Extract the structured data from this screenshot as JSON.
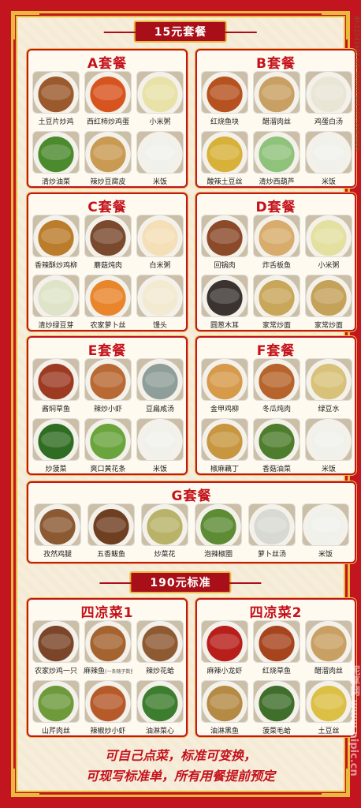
{
  "banners": {
    "set15": "15元套餐",
    "set190": "190元标准"
  },
  "sets": [
    {
      "title": "A套餐",
      "dishes": [
        {
          "name": "土豆片炒鸡",
          "color": "#9a5a2c"
        },
        {
          "name": "西红柿炒鸡蛋",
          "color": "#d8541f"
        },
        {
          "name": "小米粥",
          "color": "#e8e2a8"
        },
        {
          "name": "清炒油菜",
          "color": "#4c8a2e"
        },
        {
          "name": "辣炒豆腐皮",
          "color": "#c99a52"
        },
        {
          "name": "米饭",
          "color": "#f1f1ec"
        }
      ]
    },
    {
      "title": "B套餐",
      "dishes": [
        {
          "name": "红烧鱼块",
          "color": "#b6521f"
        },
        {
          "name": "醋溜肉丝",
          "color": "#c9a063"
        },
        {
          "name": "鸡蛋白汤",
          "color": "#e9e6d6"
        },
        {
          "name": "酸辣土豆丝",
          "color": "#d8b13a"
        },
        {
          "name": "清炒西葫芦",
          "color": "#8fc27a"
        },
        {
          "name": "米饭",
          "color": "#f1f1ec"
        }
      ]
    },
    {
      "title": "C套餐",
      "dishes": [
        {
          "name": "香辣酥炒鸡柳",
          "color": "#bb7c2b"
        },
        {
          "name": "蘑菇炖肉",
          "color": "#7a4a2f"
        },
        {
          "name": "白米粥",
          "color": "#f4dfb6"
        },
        {
          "name": "清炒绿豆芽",
          "color": "#dfe4c8"
        },
        {
          "name": "农家萝卜丝",
          "color": "#e9852a"
        },
        {
          "name": "馒头",
          "color": "#f3ead2"
        }
      ]
    },
    {
      "title": "D套餐",
      "dishes": [
        {
          "name": "回锅肉",
          "color": "#8b4a2a"
        },
        {
          "name": "炸舌板鱼",
          "color": "#d8ac6c"
        },
        {
          "name": "小米粥",
          "color": "#e3e0a0"
        },
        {
          "name": "圆葱木耳",
          "color": "#3a3330"
        },
        {
          "name": "家常炒面",
          "color": "#c9a75a"
        },
        {
          "name": "家常炒面",
          "color": "#c4a25a"
        }
      ]
    },
    {
      "title": "E套餐",
      "dishes": [
        {
          "name": "酱焖草鱼",
          "color": "#9c3a22"
        },
        {
          "name": "辣炒小虾",
          "color": "#b96a34"
        },
        {
          "name": "豆扁咸汤",
          "color": "#8f9e98"
        },
        {
          "name": "炒菠菜",
          "color": "#2f6d22"
        },
        {
          "name": "爽口黄花条",
          "color": "#6aa43c"
        },
        {
          "name": "米饭",
          "color": "#f1f1ec"
        }
      ]
    },
    {
      "title": "F套餐",
      "dishes": [
        {
          "name": "金甲鸡柳",
          "color": "#d69a4a"
        },
        {
          "name": "冬瓜炖肉",
          "color": "#b6642b"
        },
        {
          "name": "绿豆水",
          "color": "#d8c27a"
        },
        {
          "name": "椒麻藕丁",
          "color": "#c7963f"
        },
        {
          "name": "香菇油菜",
          "color": "#4d7d2d"
        },
        {
          "name": "米饭",
          "color": "#f1f1ec"
        }
      ]
    }
  ],
  "setG": {
    "title": "G套餐",
    "dishes": [
      {
        "name": "孜然鸡腿",
        "color": "#8c5a32"
      },
      {
        "name": "五香鲅鱼",
        "color": "#6f3f22"
      },
      {
        "name": "炒菜花",
        "color": "#b9b36a"
      },
      {
        "name": "泡辣椒圈",
        "color": "#5d8c35"
      },
      {
        "name": "萝卜丝汤",
        "color": "#d9d9d3"
      },
      {
        "name": "米饭",
        "color": "#f1f1ec"
      }
    ]
  },
  "cold_sets": [
    {
      "title": "四凉菜1",
      "dishes": [
        {
          "name": "农家炒鸡一只",
          "color": "#7a4528",
          "sub": ""
        },
        {
          "name": "麻辣鱼",
          "color": "#a4632f",
          "sub": "(一条随子数量)"
        },
        {
          "name": "辣炒花蛤",
          "color": "#8d5a32",
          "sub": ""
        },
        {
          "name": "山芹肉丝",
          "color": "#6e9a3c",
          "sub": ""
        },
        {
          "name": "辣椒炒小虾",
          "color": "#b65a2a",
          "sub": ""
        },
        {
          "name": "油淋菜心",
          "color": "#3d7d2e",
          "sub": ""
        }
      ]
    },
    {
      "title": "四凉菜2",
      "dishes": [
        {
          "name": "麻辣小龙虾",
          "color": "#b81f1a",
          "sub": ""
        },
        {
          "name": "红烧草鱼",
          "color": "#a6441e",
          "sub": ""
        },
        {
          "name": "醋溜肉丝",
          "color": "#c9a063",
          "sub": ""
        },
        {
          "name": "油淋黑鱼",
          "color": "#b58a45",
          "sub": ""
        },
        {
          "name": "菠菜毛蛤",
          "color": "#3f6f2b",
          "sub": ""
        },
        {
          "name": "土豆丝",
          "color": "#dcbf45",
          "sub": ""
        }
      ]
    }
  ],
  "footer": {
    "line1": "可自己点菜，标准可变换，",
    "line2": "可现写标准单，所有用餐提前预定"
  },
  "side_id": "ID:12241905 NO:20200730174724683000",
  "watermark": "昵享网 www.nipic.cn"
}
